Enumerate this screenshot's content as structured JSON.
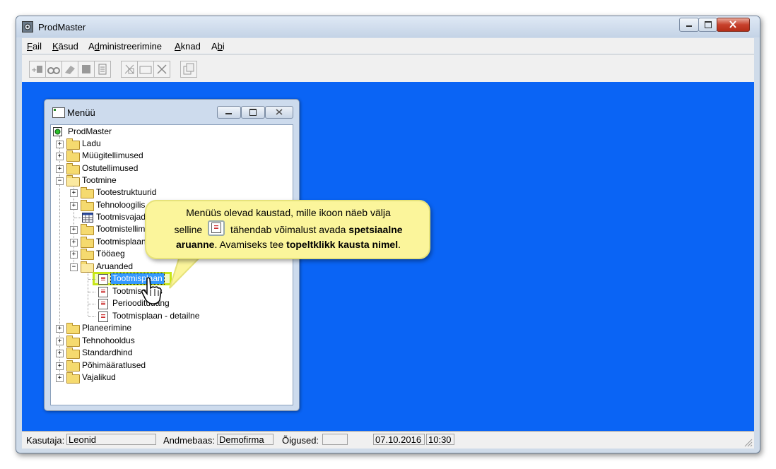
{
  "window": {
    "title": "ProdMaster"
  },
  "menubar": {
    "items": [
      "Fail",
      "Käsud",
      "Administreerimine",
      "Aknad",
      "Abi"
    ]
  },
  "toolbar": {
    "buttons": [
      "add-record",
      "find",
      "edit",
      "stop",
      "document",
      "cut",
      "folder",
      "delete",
      "copy"
    ]
  },
  "child_window": {
    "title": "Menüü"
  },
  "tree": {
    "root": "ProdMaster",
    "items": [
      "Ladu",
      "Müügitellimused",
      "Ostutellimused",
      "Tootmine"
    ],
    "tootmine_children": [
      "Tootestruktuurid",
      "Tehnoloogilis",
      "Tootmisvajad",
      "Tootmistellim",
      "Tootmisplaan",
      "Tööaeg",
      "Aruanded"
    ],
    "aruanded_children": [
      "Tootmisplaan",
      "Tootmisemus",
      "Periooditudang",
      "Tootmisplaan - detailne"
    ],
    "after": [
      "Planeerimine",
      "Tehnohooldus",
      "Standardhind",
      "Põhimääratlused",
      "Vajalikud"
    ]
  },
  "callout": {
    "line1": "Menüüs olevad kaustad, mille ikoon näeb välja",
    "line2_a": "selline",
    "line2_b": "tähendab võimalust avada",
    "line2_bold": "spetsiaalne",
    "line3_bold1": "aruanne",
    "line3_a": ".  Avamiseks tee",
    "line3_bold2": "topeltklikk kausta nimel",
    "line3_end": "."
  },
  "status": {
    "user_label": "Kasutaja:",
    "user_value": "Leonid",
    "db_label": "Andmebaas:",
    "db_value": "Demofirma",
    "rights_label": "Õigused:",
    "rights_value": "",
    "date": "07.10.2016",
    "time": "10:30"
  },
  "colors": {
    "desktop": "#0a64f5",
    "callout_bg": "#fbf59b",
    "selection": "#3399ff"
  }
}
